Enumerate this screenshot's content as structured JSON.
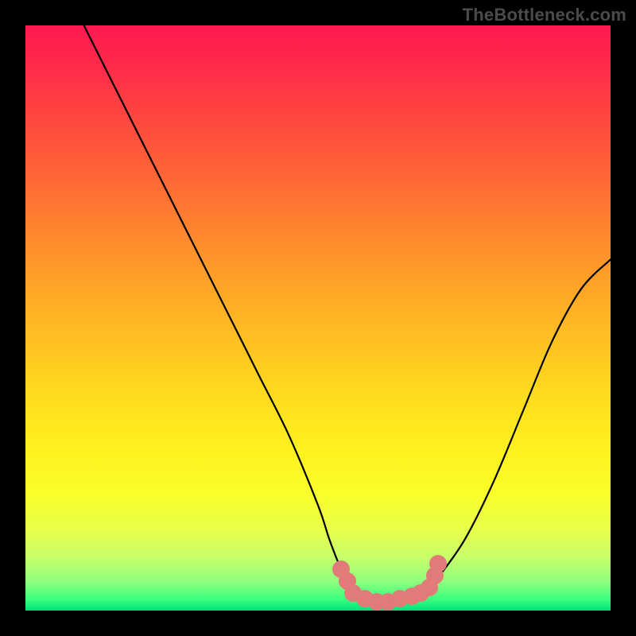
{
  "watermark": "TheBottleneck.com",
  "chart_data": {
    "type": "line",
    "title": "",
    "xlabel": "",
    "ylabel": "",
    "xlim": [
      0,
      100
    ],
    "ylim": [
      0,
      100
    ],
    "grid": false,
    "series": [
      {
        "name": "bottleneck-curve",
        "x": [
          10,
          15,
          20,
          25,
          30,
          35,
          40,
          45,
          50,
          52,
          54,
          56,
          58,
          60,
          62,
          64,
          66,
          68,
          70,
          75,
          80,
          85,
          90,
          95,
          100
        ],
        "values": [
          100,
          90,
          80,
          70,
          60,
          50,
          40,
          30,
          18,
          12,
          7,
          4,
          2,
          1,
          1,
          1,
          2,
          3,
          5,
          12,
          22,
          34,
          46,
          55,
          60
        ]
      }
    ],
    "markers": {
      "name": "highlight-dots",
      "color": "#e27a79",
      "points": [
        {
          "x": 54,
          "y": 7
        },
        {
          "x": 55,
          "y": 5
        },
        {
          "x": 56,
          "y": 3
        },
        {
          "x": 58,
          "y": 2
        },
        {
          "x": 60,
          "y": 1.5
        },
        {
          "x": 62,
          "y": 1.5
        },
        {
          "x": 64,
          "y": 2
        },
        {
          "x": 66,
          "y": 2.5
        },
        {
          "x": 67.5,
          "y": 3
        },
        {
          "x": 69,
          "y": 4
        },
        {
          "x": 70,
          "y": 6
        },
        {
          "x": 70.5,
          "y": 8
        }
      ]
    },
    "background_gradient": {
      "top": "#ff1850",
      "mid": "#ffd81f",
      "bottom": "#00e07a"
    }
  }
}
